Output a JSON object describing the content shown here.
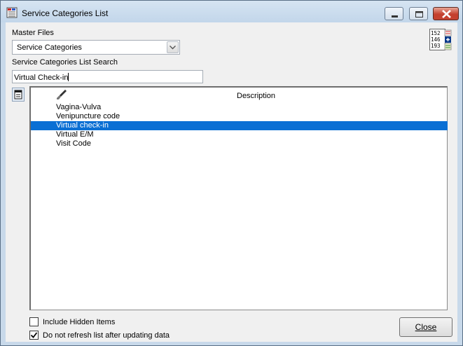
{
  "window": {
    "title": "Service Categories List"
  },
  "master_files": {
    "label": "Master Files",
    "selected": "Service Categories"
  },
  "search": {
    "label": "Service Categories List Search",
    "value": "Virtual Check-in"
  },
  "list": {
    "column_header": "Description",
    "items": [
      {
        "label": "Vagina-Vulva",
        "selected": false
      },
      {
        "label": "Venipuncture code",
        "selected": false
      },
      {
        "label": "Virtual check-in",
        "selected": true
      },
      {
        "label": "Virtual E/M",
        "selected": false
      },
      {
        "label": "Visit Code",
        "selected": false
      }
    ]
  },
  "options": {
    "include_hidden_label": "Include Hidden Items",
    "include_hidden_checked": false,
    "no_refresh_label": "Do not refresh list after updating data",
    "no_refresh_checked": true
  },
  "buttons": {
    "close_label": "Close"
  },
  "icons": {
    "numbers_icon": "152 146 193",
    "selection_color": "#0a6fd4"
  }
}
